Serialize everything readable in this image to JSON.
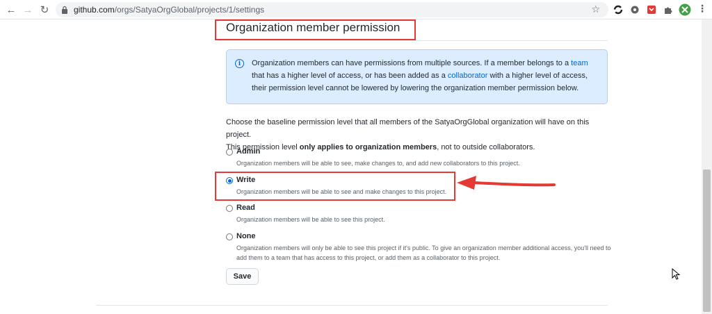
{
  "browser": {
    "url_host": "github.com",
    "url_path": "/orgs/SatyaOrgGlobal/projects/1/settings",
    "icons": [
      "back-arrow-icon",
      "forward-arrow-icon",
      "reload-icon",
      "lock-icon",
      "bookmark-star-icon",
      "extension-icons",
      "menu-dots-icon"
    ]
  },
  "page": {
    "title": "Organization member permission",
    "notice": {
      "text_1": "Organization members can have permissions from multiple sources. If a member belongs to a ",
      "link_team": "team",
      "text_2": " that has a higher level of access, or has been added as a ",
      "link_collaborator": "collaborator",
      "text_3": " with a higher level of access, their permission level cannot be lowered by lowering the organization member permission below."
    },
    "description": {
      "line1": "Choose the baseline permission level that all members of the SatyaOrgGlobal organization will have on this project.",
      "line2_a": "This permission level ",
      "line2_bold": "only applies to organization members",
      "line2_b": ", not to outside collaborators."
    },
    "options": [
      {
        "label": "Admin",
        "note": "Organization members will be able to see, make changes to, and add new collaborators to this project.",
        "checked": false
      },
      {
        "label": "Write",
        "note": "Organization members will be able to see and make changes to this project.",
        "checked": true
      },
      {
        "label": "Read",
        "note": "Organization members will be able to see this project.",
        "checked": false
      },
      {
        "label": "None",
        "note": "Organization members will only be able to see this project if it's public. To give an organization member additional access, you'll need to add them to a team that has access to this project, or add them as a collaborator to this project.",
        "checked": false
      }
    ],
    "save_label": "Save"
  },
  "colors": {
    "annotation": "#e53935",
    "link": "#0366d6",
    "notice_bg": "#dbedff"
  }
}
